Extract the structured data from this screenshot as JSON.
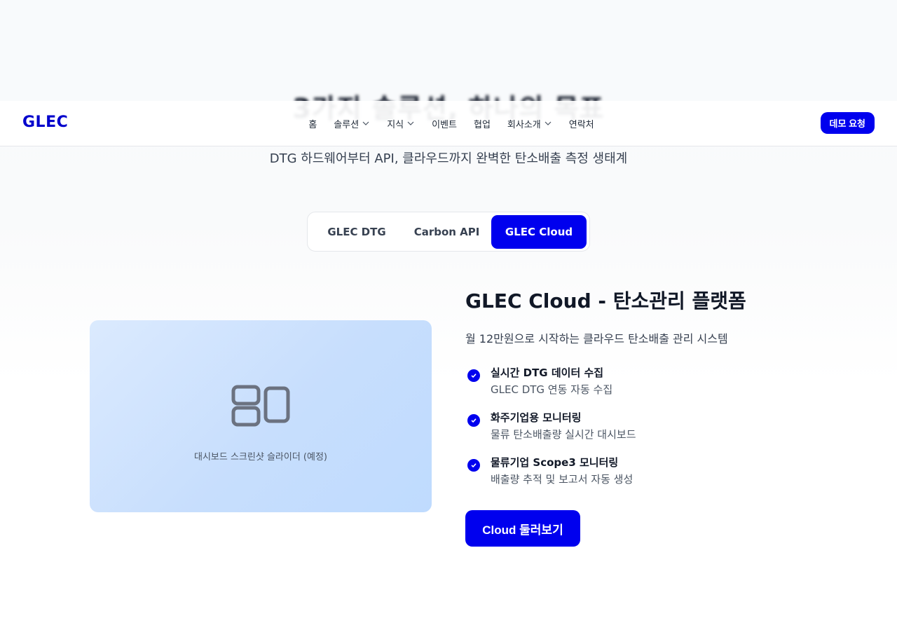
{
  "hero": {
    "title": "3가지 솔루션, 하나의 목표",
    "subtitle": "DTG 하드웨어부터 API, 클라우드까지 완벽한 탄소배출 측정 생태계"
  },
  "header": {
    "logo": "GLEC",
    "nav": [
      {
        "label": "홈",
        "has_dropdown": false
      },
      {
        "label": "솔루션",
        "has_dropdown": true
      },
      {
        "label": "지식",
        "has_dropdown": true
      },
      {
        "label": "이벤트",
        "has_dropdown": false
      },
      {
        "label": "협업",
        "has_dropdown": false
      },
      {
        "label": "회사소개",
        "has_dropdown": true
      },
      {
        "label": "연락처",
        "has_dropdown": false
      }
    ],
    "demo_button": "데모 요청"
  },
  "tabs": [
    {
      "label": "GLEC DTG",
      "active": false
    },
    {
      "label": "Carbon API",
      "active": false
    },
    {
      "label": "GLEC Cloud",
      "active": true
    }
  ],
  "preview": {
    "icon": "dashboard-icon",
    "caption": "대시보드 스크린샷 슬라이더 (예정)"
  },
  "product": {
    "title": "GLEC Cloud - 탄소관리 플랫폼",
    "description": "월 12만원으로 시작하는 클라우드 탄소배출 관리 시스템",
    "features": [
      {
        "title": "실시간 DTG 데이터 수집",
        "subtitle": "GLEC DTG 연동 자동 수집"
      },
      {
        "title": "화주기업용 모니터링",
        "subtitle": "물류 탄소배출량 실시간 대시보드"
      },
      {
        "title": "물류기업 Scope3 모니터링",
        "subtitle": "배출량 추적 및 보고서 자동 생성"
      }
    ],
    "cta": "Cloud 둘러보기"
  },
  "colors": {
    "accent": "#0000ee",
    "logo": "#0000cc",
    "preview_bg": "#c7defd"
  }
}
